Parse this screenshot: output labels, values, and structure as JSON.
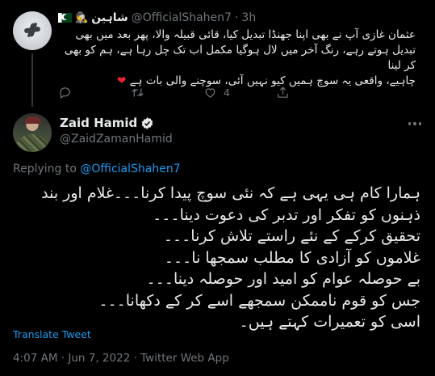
{
  "parent_tweet": {
    "display_name": "شاہین",
    "handle": "@OfficialShahen7",
    "time": "3h",
    "separator": "·",
    "emoji": "🕵",
    "body_lines": [
      "عثمان غازی آپ نے بھی اپنا جھنڈا تبدیل کیا، قائی قبیلہ والا، پھر بعد میں بھی",
      "تبدیل ہوتے رہے، رنگ آخر میں لال ہوگیا مکمل اب تک چل رہا ہے، ہم کو بھی کر لینا",
      "چاہیے، واقعی یہ سوچ ہمیں کیو نہیں آئی، سوچنے والی بات ہے"
    ],
    "heart_emoji": "❤",
    "actions": {
      "reply_count": "",
      "retweet_count": "",
      "like_count": "4"
    }
  },
  "main_tweet": {
    "display_name": "Zaid Hamid",
    "handle": "@ZaidZamanHamid",
    "replying_prefix": "Replying to",
    "replying_to": "@OfficialShahen7",
    "body_lines": [
      "ہمارا کام ہی یہی ہے کہ نئی سوچ پیدا کرنا۔۔۔غلام اور بند",
      "ذہنوں کو تفکر اور تدبر کی دعوت دینا۔۔۔",
      "تحقیق کرکے کے نئے راستے تلاش کرنا۔۔۔",
      "غلاموں کو آزادی کا مطلب سمجھا نا۔۔۔",
      "بے حوصلہ عوام کو امید اور حوصلہ دینا۔۔۔",
      "جس کو قوم ناممکن سمجھے اسے کر کے دکھانا۔۔۔",
      "اسی کو تعمیرات کہتے ہیں۔"
    ],
    "translate_label": "Translate Tweet",
    "timestamp": "4:07 AM · Jun 7, 2022 · Twitter Web App"
  },
  "colors": {
    "background": "#000000",
    "text": "#e7e9ea",
    "muted": "#71767b",
    "accent": "#1d9bf0",
    "heart": "#f4212e"
  },
  "icons": [
    "spy-icon",
    "pakistan-flag-icon",
    "reply-icon",
    "retweet-icon",
    "like-icon",
    "share-icon",
    "verified-badge-icon",
    "more-icon"
  ]
}
